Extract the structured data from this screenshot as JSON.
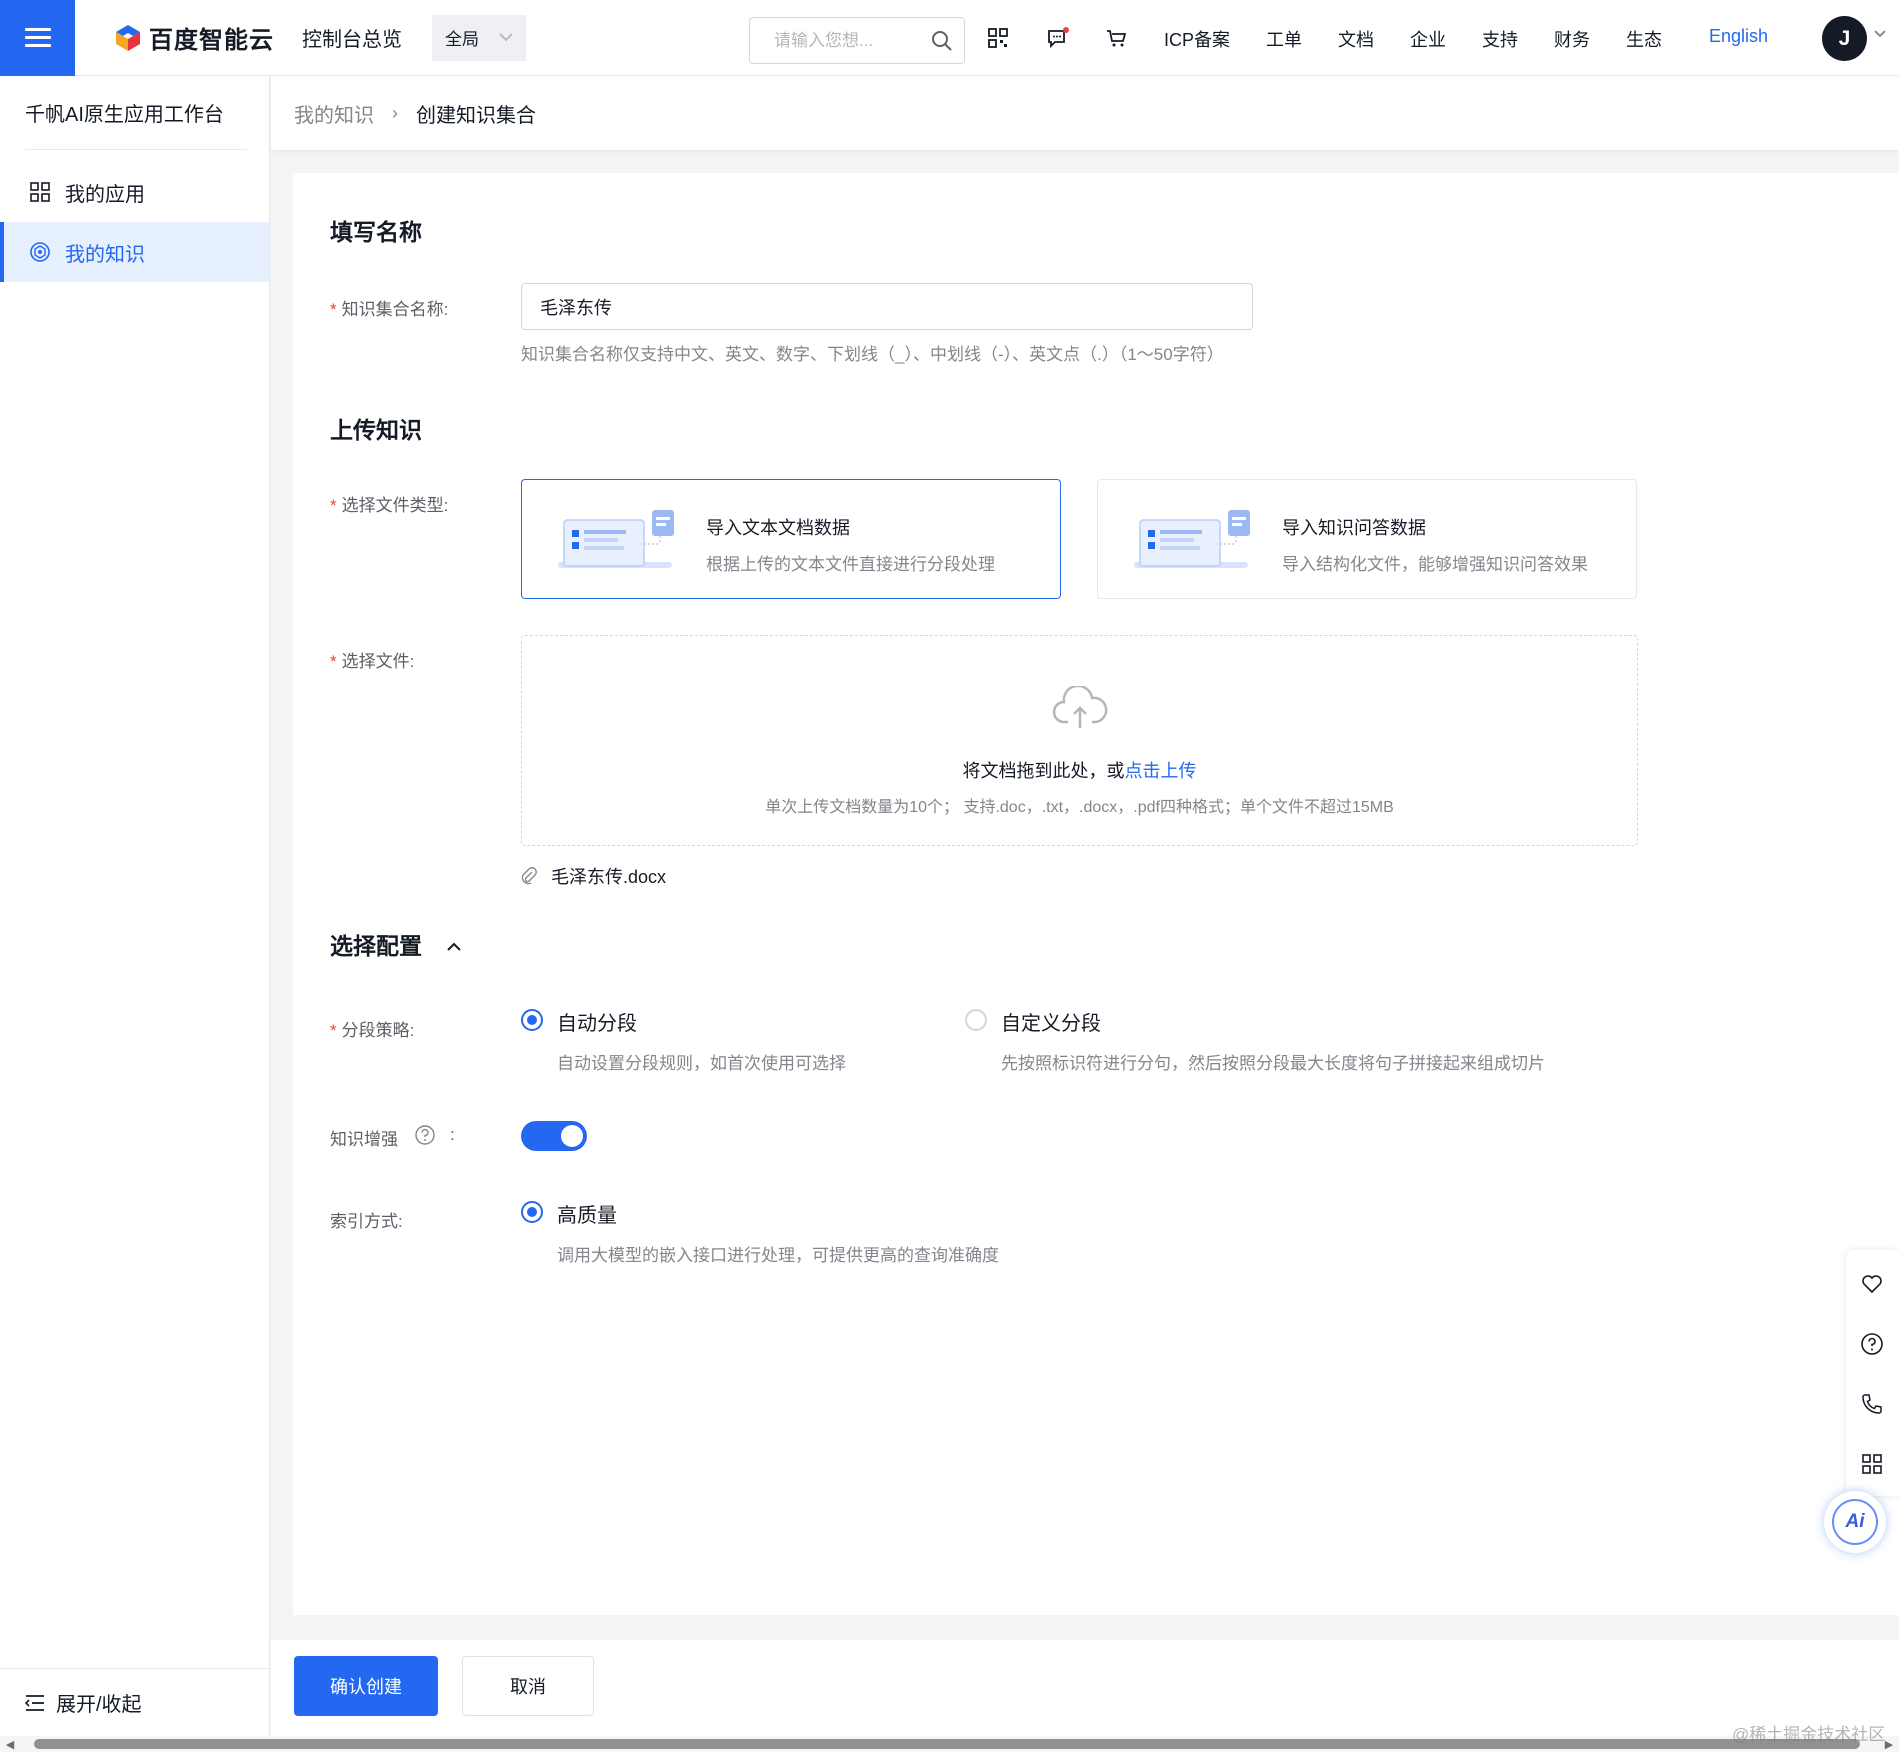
{
  "header": {
    "brand": "百度智能云",
    "console": "控制台总览",
    "region": "全局",
    "search_placeholder": "请输入您想...",
    "nav": [
      "ICP备案",
      "工单",
      "文档",
      "企业",
      "支持",
      "财务",
      "生态"
    ],
    "lang": "English",
    "avatar": "J"
  },
  "sidebar": {
    "title": "千帆AI原生应用工作台",
    "items": [
      {
        "label": "我的应用",
        "icon": "grid-icon"
      },
      {
        "label": "我的知识",
        "icon": "knowledge-icon"
      }
    ],
    "footer": "展开/收起"
  },
  "breadcrumb": {
    "parent": "我的知识",
    "sep": "›",
    "current": "创建知识集合"
  },
  "form": {
    "name_section": "填写名称",
    "name_label": "知识集合名称:",
    "name_value": "毛泽东传",
    "name_hint": "知识集合名称仅支持中文、英文、数字、下划线（_）、中划线（-）、英文点（.）（1～50字符）",
    "upload_section": "上传知识",
    "type_label": "选择文件类型:",
    "types": [
      {
        "title": "导入文本文档数据",
        "desc": "根据上传的文本文件直接进行分段处理",
        "selected": true
      },
      {
        "title": "导入知识问答数据",
        "desc": "导入结构化文件，能够增强知识问答效果",
        "selected": false
      }
    ],
    "file_label": "选择文件:",
    "dropzone_text": "将文档拖到此处，或",
    "dropzone_link": "点击上传",
    "dropzone_tip": "单次上传文档数量为10个； 支持.doc，.txt，.docx，.pdf四种格式；单个文件不超过15MB",
    "uploaded_file": "毛泽东传.docx",
    "config_section": "选择配置",
    "strategy_label": "分段策略:",
    "strategies": [
      {
        "label": "自动分段",
        "desc": "自动设置分段规则，如首次使用可选择",
        "checked": true
      },
      {
        "label": "自定义分段",
        "desc": "先按照标识符进行分句，然后按照分段最大长度将句子拼接起来组成切片",
        "checked": false
      }
    ],
    "enhance_label": "知识增强",
    "enhance_colon": ":",
    "enhance_on": true,
    "index_label": "索引方式:",
    "index_option": {
      "label": "高质量",
      "desc": "调用大模型的嵌入接口进行处理，可提供更高的查询准确度",
      "checked": true
    }
  },
  "actions": {
    "confirm": "确认创建",
    "cancel": "取消"
  },
  "float_tools": [
    "heart-icon",
    "help-circle-icon",
    "phone-icon",
    "apps-icon"
  ],
  "ai_button": "Ai",
  "watermark": "@稀土掘金技术社区",
  "colors": {
    "primary": "#2468f2",
    "required": "#f33e3e",
    "muted": "#84868c"
  }
}
